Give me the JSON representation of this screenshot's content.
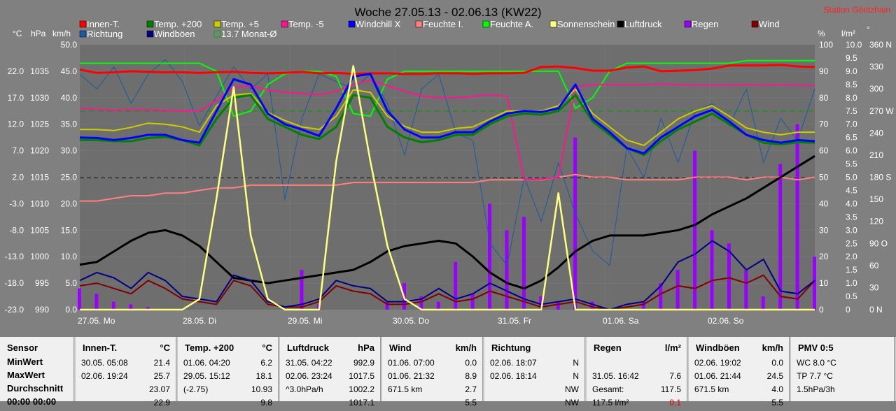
{
  "window": {
    "title": "Woche 27.05.13 - 02.06.13 (KW22)",
    "station": "Station Göritzhain"
  },
  "legend": [
    {
      "label": "Innen-T.",
      "color": "#ff0000"
    },
    {
      "label": "Temp. +200",
      "color": "#008000"
    },
    {
      "label": "Temp. +5",
      "color": "#cccc00"
    },
    {
      "label": "Temp. -5",
      "color": "#ff1493"
    },
    {
      "label": "Windchill X",
      "color": "#0000ff"
    },
    {
      "label": "Feuchte I.",
      "color": "#ff8080"
    },
    {
      "label": "Feuchte A.",
      "color": "#00ff00"
    },
    {
      "label": "Sonnenschein",
      "color": "#ffff80"
    },
    {
      "label": "Luftdruck",
      "color": "#000000"
    },
    {
      "label": "Regen",
      "color": "#9900ff"
    },
    {
      "label": "Wind",
      "color": "#800000"
    },
    {
      "label": "Richtung",
      "color": "#1a5aa0"
    },
    {
      "label": "Windböen",
      "color": "#000080"
    },
    {
      "label": "13.7 Monat-Ø",
      "color": "#00b000"
    }
  ],
  "chart_data": {
    "type": "line",
    "title": "Woche 27.05.13 - 02.06.13 (KW22)",
    "x_labels": [
      "27.05. Mo",
      "28.05. Di",
      "29.05. Mi",
      "30.05. Do",
      "31.05. Fr",
      "01.06. Sa",
      "02.06. So"
    ],
    "axes": {
      "temp_c": {
        "unit": "°C",
        "ticks": [
          "22.0",
          "17.0",
          "12.0",
          "7.0",
          "2.0",
          "-3.0",
          "-8.0",
          "-13.0",
          "-18.0",
          "-23.0"
        ],
        "range": [
          -23,
          27
        ]
      },
      "pressure_hpa": {
        "unit": "hPa",
        "ticks": [
          "1035",
          "1030",
          "1025",
          "1020",
          "1015",
          "1010",
          "1005",
          "1000",
          "995",
          "990"
        ],
        "range": [
          990,
          1040
        ]
      },
      "wind_kmh": {
        "unit": "km/h",
        "ticks": [
          "50.0",
          "45.0",
          "40.0",
          "35.0",
          "30.0",
          "25.0",
          "20.0",
          "15.0",
          "10.0",
          "5.0",
          "0.0"
        ],
        "range": [
          0,
          50
        ]
      },
      "humidity_pct": {
        "unit": "%",
        "ticks": [
          "100",
          "90",
          "80",
          "70",
          "60",
          "50",
          "40",
          "30",
          "20",
          "10",
          "0"
        ],
        "range": [
          0,
          100
        ]
      },
      "rain_lm2": {
        "unit": "l/m²",
        "ticks": [
          "10.0",
          "9.5",
          "9.0",
          "8.5",
          "8.0",
          "7.5",
          "7.0",
          "6.5",
          "6.0",
          "5.5",
          "5.0",
          "4.5",
          "4.0",
          "3.5",
          "3.0",
          "2.5",
          "2.0",
          "1.5",
          "1.0",
          "0.5",
          "0"
        ],
        "range": [
          0,
          10
        ]
      },
      "direction_deg": {
        "unit": "°",
        "ticks": [
          "360 N",
          "330",
          "300",
          "270 W",
          "240",
          "210",
          "180 S",
          "150",
          "120",
          "90 O",
          "60",
          "30",
          "0 N"
        ],
        "range": [
          0,
          360
        ]
      }
    },
    "monthly_avg_temp": 13.7,
    "series": [
      {
        "name": "Innen-T.",
        "axis": "temp_c",
        "values": [
          22.3,
          21.7,
          21.8,
          22.0,
          21.9,
          21.8,
          21.8,
          21.7,
          21.8,
          21.9,
          21.7,
          21.6,
          21.7,
          21.9,
          21.6,
          21.7,
          21.5,
          21.6,
          21.6,
          21.5,
          21.5,
          21.6,
          21.6,
          21.5,
          21.6,
          21.6,
          21.7,
          22.8,
          22.9,
          22.6,
          22.1,
          22.1,
          22.7,
          22.9,
          22.0,
          22.1,
          22.2,
          22.5,
          23.1,
          23.1,
          23.1,
          23.2,
          22.9,
          22.8
        ]
      },
      {
        "name": "Temp. +200",
        "axis": "temp_c",
        "values": [
          9.0,
          9.0,
          8.8,
          8.8,
          9.4,
          9.6,
          9.0,
          8.0,
          13.0,
          17.0,
          17.5,
          13.0,
          11.5,
          10.0,
          9.2,
          11.5,
          17.5,
          17.0,
          11.5,
          9.5,
          8.6,
          9.0,
          10.0,
          10.0,
          12.0,
          13.5,
          14.0,
          13.8,
          14.5,
          17.5,
          12.5,
          10.0,
          7.5,
          6.2,
          8.8,
          11.0,
          12.5,
          14.0,
          12.0,
          10.0,
          8.5,
          8.2,
          8.6,
          8.5
        ]
      },
      {
        "name": "Temp. +5",
        "axis": "temp_c",
        "values": [
          11.0,
          11.0,
          10.8,
          11.4,
          12.2,
          12.0,
          11.5,
          10.5,
          15.5,
          17.5,
          17.8,
          14.2,
          12.7,
          11.5,
          11.0,
          13.5,
          18.5,
          18.0,
          13.5,
          11.6,
          10.5,
          10.5,
          11.2,
          11.5,
          13.0,
          14.5,
          14.5,
          14.5,
          15.5,
          18.6,
          14.0,
          11.5,
          9.0,
          8.0,
          10.5,
          13.0,
          14.5,
          15.5,
          13.5,
          11.3,
          10.5,
          10.0,
          10.5,
          10.5
        ]
      },
      {
        "name": "Temp. -5",
        "axis": "temp_c",
        "values": [
          15.0,
          14.8,
          14.6,
          14.8,
          14.7,
          14.6,
          14.5,
          14.5,
          16.5,
          19.0,
          19.2,
          18.5,
          18.0,
          17.8,
          17.6,
          18.2,
          19.5,
          20.3,
          19.3,
          18.2,
          17.3,
          17.0,
          17.0,
          17.2,
          17.6,
          17.2,
          1.5,
          1.6,
          2.0,
          19.0,
          19.5,
          19.5,
          19.5,
          19.5,
          19.6,
          19.5,
          19.4,
          19.4,
          19.4,
          19.5,
          19.4,
          19.5,
          19.4,
          19.3
        ]
      },
      {
        "name": "Windchill X",
        "axis": "temp_c",
        "values": [
          9.5,
          9.4,
          9.0,
          9.4,
          10.0,
          10.0,
          9.0,
          8.5,
          14.5,
          20.5,
          19.5,
          14.0,
          12.0,
          11.0,
          9.8,
          15.0,
          21.0,
          21.5,
          14.5,
          11.0,
          9.5,
          9.5,
          10.5,
          10.5,
          12.5,
          14.0,
          14.5,
          14.3,
          15.0,
          19.5,
          13.0,
          10.5,
          7.5,
          6.5,
          9.5,
          11.5,
          13.5,
          14.7,
          12.5,
          10.0,
          9.0,
          8.5,
          9.0,
          8.8
        ]
      },
      {
        "name": "Feuchte I.",
        "axis": "humidity_pct",
        "values": [
          41,
          41,
          42,
          43,
          43,
          44,
          44,
          45,
          46,
          46,
          47,
          47,
          47,
          47,
          47,
          47,
          48,
          48,
          48,
          48,
          48,
          48,
          48,
          48,
          49,
          49,
          49,
          49,
          50,
          51,
          50,
          50,
          49,
          49,
          49,
          49,
          50,
          50,
          50,
          49,
          50,
          50,
          49,
          50
        ]
      },
      {
        "name": "Feuchte A.",
        "axis": "humidity_pct",
        "values": [
          93,
          93,
          93,
          93,
          93,
          93,
          93,
          93,
          90,
          73,
          75,
          85,
          89,
          90,
          90,
          88,
          74,
          73,
          87,
          90,
          90,
          90,
          90,
          90,
          90,
          90,
          90,
          90,
          90,
          76,
          80,
          90,
          93,
          93,
          93,
          93,
          93,
          93,
          93,
          94,
          94,
          94,
          94,
          94
        ]
      },
      {
        "name": "Luftdruck",
        "axis": "pressure_hpa",
        "values": [
          998.5,
          999,
          1001,
          1003,
          1004.5,
          1005,
          1004,
          1002,
          999,
          996,
          995.5,
          995,
          995.5,
          996,
          996.5,
          997,
          997.5,
          999,
          1001,
          1002,
          1002.5,
          1003,
          1002.5,
          1000,
          997,
          995,
          994,
          995.5,
          998,
          1001,
          1003,
          1004,
          1004,
          1004,
          1004.5,
          1005,
          1006,
          1008,
          1009.5,
          1011,
          1013,
          1015,
          1017,
          1019
        ]
      },
      {
        "name": "Sonnenschein",
        "axis": "wind_kmh",
        "values": [
          0,
          0,
          0,
          0,
          0,
          0,
          0,
          2,
          21,
          42,
          14,
          2,
          0,
          0,
          0,
          28,
          46,
          28,
          12,
          2,
          0,
          0,
          0,
          0,
          0,
          0,
          0,
          0,
          22,
          0,
          0,
          0,
          0,
          0,
          0,
          0,
          0,
          0,
          0,
          0,
          0,
          0,
          0,
          0
        ]
      },
      {
        "name": "Regen",
        "axis": "rain_lm2",
        "values": [
          0.8,
          0.6,
          0.3,
          0.2,
          0.1,
          0.0,
          0.0,
          0.0,
          0.0,
          0.0,
          0.0,
          0.0,
          0.0,
          1.5,
          0.2,
          0.0,
          0.0,
          0.0,
          0.3,
          1.0,
          0.5,
          0.3,
          1.8,
          0.6,
          4.0,
          3.0,
          3.5,
          0.5,
          0.3,
          6.5,
          0.3,
          0.0,
          0.0,
          0.3,
          1.0,
          1.5,
          6.0,
          3.0,
          2.5,
          1.5,
          0.5,
          5.5,
          7.0,
          2.0
        ]
      },
      {
        "name": "Wind",
        "axis": "wind_kmh",
        "values": [
          4.5,
          5.0,
          4.0,
          3.0,
          5.5,
          4.0,
          2.0,
          1.5,
          1.0,
          5.5,
          4.5,
          1.0,
          0.5,
          0.5,
          1.5,
          4.5,
          3.5,
          3.0,
          1.0,
          1.0,
          1.5,
          3.0,
          1.5,
          2.0,
          3.5,
          2.5,
          1.5,
          0.5,
          1.0,
          1.5,
          0.5,
          0.0,
          0.5,
          1.0,
          3.0,
          4.5,
          4.0,
          5.5,
          6.0,
          5.0,
          6.5,
          2.5,
          2.0,
          5.5
        ]
      },
      {
        "name": "Windböen",
        "axis": "wind_kmh",
        "values": [
          5.5,
          7.0,
          6.0,
          4.0,
          7.0,
          5.5,
          2.5,
          2.0,
          1.5,
          6.5,
          5.5,
          1.5,
          0.5,
          1.0,
          2.0,
          5.5,
          4.5,
          4.0,
          1.5,
          1.5,
          2.0,
          4.0,
          2.0,
          3.0,
          5.0,
          3.5,
          2.0,
          1.0,
          1.5,
          2.0,
          1.0,
          0.0,
          1.0,
          1.5,
          4.5,
          9.0,
          10.5,
          13.0,
          11.0,
          7.5,
          9.5,
          3.5,
          3.0,
          5.5
        ]
      },
      {
        "name": "Richtung",
        "axis": "direction_deg",
        "values": [
          320,
          300,
          330,
          280,
          320,
          340,
          310,
          250,
          290,
          330,
          300,
          320,
          150,
          260,
          320,
          310,
          300,
          320,
          280,
          210,
          300,
          320,
          240,
          230,
          90,
          60,
          180,
          120,
          200,
          130,
          80,
          60,
          220,
          180,
          260,
          200,
          270,
          280,
          250,
          300,
          200,
          260,
          230,
          300
        ]
      }
    ]
  },
  "table": [
    {
      "name": "Sensor",
      "cols": [
        {
          "label": "Sensor",
          "unit": ""
        },
        {
          "rows": [
            "MinWert",
            "MaxWert",
            "Durchschnitt",
            "00:00 00:00"
          ]
        }
      ]
    },
    {
      "name": "Innen-T.",
      "unit": "°C",
      "rows": [
        [
          "30.05. 05:08",
          "21.4"
        ],
        [
          "02.06. 19:24",
          "25.7"
        ],
        [
          "",
          "23.07"
        ],
        [
          "",
          "22.9"
        ]
      ]
    },
    {
      "name": "Temp. +200",
      "unit": "°C",
      "rows": [
        [
          "01.06. 04:20",
          "6.2"
        ],
        [
          "29.05. 15:12",
          "18.1"
        ],
        [
          "(-2.75)",
          "10.93"
        ],
        [
          "",
          "9.8"
        ]
      ]
    },
    {
      "name": "Luftdruck",
      "unit": "hPa",
      "rows": [
        [
          "31.05. 04:22",
          "992.9"
        ],
        [
          "02.06. 23:24",
          "1017.5"
        ],
        [
          "^3.0hPa/h",
          "1002.2"
        ],
        [
          "",
          "1017.1"
        ]
      ]
    },
    {
      "name": "Wind",
      "unit": "km/h",
      "rows": [
        [
          "01.06. 07:00",
          "0.0"
        ],
        [
          "01.06. 21:32",
          "8.9"
        ],
        [
          "671.5 km",
          "2.7"
        ],
        [
          "",
          "5.5"
        ]
      ]
    },
    {
      "name": "Richtung",
      "unit": "",
      "rows": [
        [
          "02.06. 18:07",
          "N"
        ],
        [
          "02.06. 18:14",
          "N"
        ],
        [
          "",
          "NW"
        ],
        [
          "",
          "NW"
        ]
      ]
    },
    {
      "name": "Regen",
      "unit": "l/m²",
      "rows": [
        [
          "",
          ""
        ],
        [
          "31.05. 16:42",
          "7.6"
        ],
        [
          "Gesamt:",
          "117.5"
        ],
        [
          "117.5 l/m²",
          "0.1"
        ]
      ]
    },
    {
      "name": "Windböen",
      "unit": "km/h",
      "rows": [
        [
          "02.06. 19:02",
          "0.0"
        ],
        [
          "01.06. 21:44",
          "24.5"
        ],
        [
          "671.5 km",
          "4.0"
        ],
        [
          "",
          "5.5"
        ]
      ]
    },
    {
      "name": "PMV 0:5",
      "unit": "",
      "rows": [
        [
          "WC 8.0 °C",
          ""
        ],
        [
          "TP 7.7 °C",
          ""
        ],
        [
          "1.5hPa/3h",
          ""
        ],
        [
          "",
          ""
        ]
      ]
    }
  ]
}
